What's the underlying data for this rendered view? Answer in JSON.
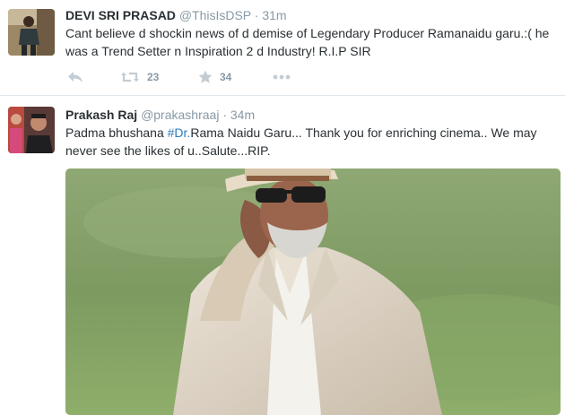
{
  "tweets": [
    {
      "name": "DEVI SRI PRASAD",
      "handle": "@ThisIsDSP",
      "separator": "·",
      "time": "31m",
      "text": "Cant believe d shockin news of d demise of Legendary Producer Ramanaidu garu.:( he was a Trend Setter n Inspiration 2 d Industry! R.I.P SIR",
      "actions": {
        "reply_icon": "reply-icon",
        "retweet_icon": "retweet-icon",
        "retweet_count": "23",
        "favorite_icon": "star-icon",
        "favorite_count": "34",
        "more_icon": "more-icon"
      }
    },
    {
      "name": "Prakash Raj",
      "handle": "@prakashraaj",
      "separator": "·",
      "time": "34m",
      "text_before": "Padma bhushana ",
      "hashtag": "#Dr.",
      "text_after": "Rama Naidu Garu... Thank you for enriching cinema.. We may never see the likes of u..Salute...RIP."
    }
  ],
  "colors": {
    "text": "#292f33",
    "muted": "#8899a6",
    "link": "#2b7bb9",
    "divider": "#e1e8ed"
  }
}
